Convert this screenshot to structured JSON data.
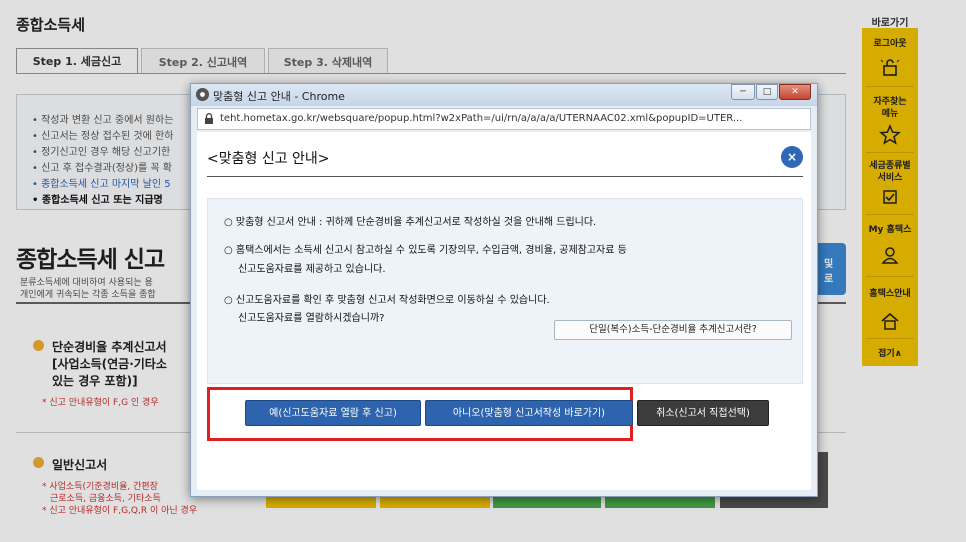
{
  "page": {
    "title": "종합소득세",
    "tabs": [
      "Step 1. 세금신고",
      "Step 2. 신고내역",
      "Step 3. 삭제내역"
    ],
    "notices": [
      "작성과 변환 신고 중에서 원하는",
      "신고서는 정상 접수된 것에 한하",
      "정기신고인 경우 해당 신고기한",
      "신고 후 접수결과(정상)를 꼭 확",
      "종합소득세 신고 마지막 날인 5",
      "종합소득세 신고 또는 지급명"
    ],
    "big_title": "종합소득세 신고",
    "desc_lines": [
      "분류소득세에 대비하여 사용되는 용",
      "개인에게 귀속되는 각종 소득을 종합"
    ],
    "side_button": "및\n로",
    "section1": {
      "title_lines": [
        "단순경비율 추계신고서",
        "[사업소득(연금·기타소",
        "있는 경우 포함)]"
      ],
      "note": "* 신고 안내유형이 F,G 인 경우"
    },
    "section2": {
      "title": "일반신고서",
      "notes": [
        "* 사업소득(기준경비율, 간편장",
        "근로소득, 금융소득, 기타소득",
        "* 신고 안내유형이 F,G,Q,R 이 아닌 경우"
      ]
    }
  },
  "quick_menu": {
    "title": "바로가기",
    "items": [
      {
        "label": "로그아웃",
        "icon": "lock-icon"
      },
      {
        "label": "자주찾는\n메뉴",
        "icon": "star-icon"
      },
      {
        "label": "세금종류별\n서비스",
        "icon": "check-icon"
      },
      {
        "label": "My 홈택스",
        "icon": "person-icon"
      },
      {
        "label": "홈택스안내",
        "icon": "home-icon"
      }
    ],
    "collapse": "접기∧"
  },
  "popup": {
    "window_title": "맞춤형 신고 안내 - Chrome",
    "window_buttons": [
      "─",
      "□",
      "✕"
    ],
    "url": "teht.hometax.go.kr/websquare/popup.html?w2xPath=/ui/rn/a/a/a/a/UTERNAAC02.xml&popupID=UTER...",
    "dialog_title": "<맞춤형 신고 안내>",
    "close_label": "×",
    "info_lines": [
      "○ 맞춤형 신고서 안내 : 귀하께 단순경비율 추계신고서로 작성하실 것을 안내해 드립니다.",
      "○ 홈택스에서는 소득세 신고시 참고하실 수 있도록 기장의무, 수입금액, 경비율, 공제참고자료 등",
      "신고도움자료를 제공하고 있습니다.",
      "○ 신고도움자료를 확인 후 맞춤형 신고서 작성화면으로 이동하실 수 있습니다.",
      "신고도움자료를 열람하시겠습니까?"
    ],
    "sub_link": "단일(복수)소득-단순경비율 추계신고서란?",
    "buttons": {
      "yes": "예(신고도움자료 열람 후 신고)",
      "no": "아니오(맞춤형 신고서작성 바로가기)",
      "cancel": "취소(신고서 직접선택)"
    },
    "colors": {
      "primary": "#2d64ad",
      "highlight": "#e02020",
      "dark": "#3c3c3c"
    }
  }
}
